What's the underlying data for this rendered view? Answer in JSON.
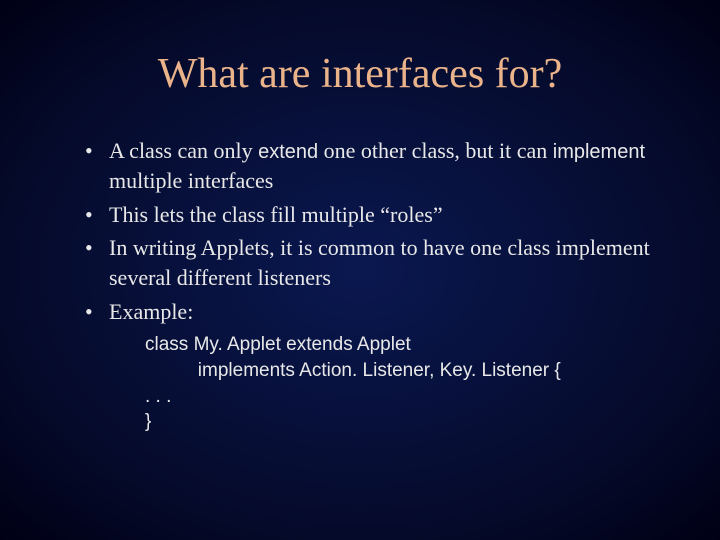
{
  "slide": {
    "title": "What are interfaces for?",
    "bullets": {
      "b1_a": "A class can only ",
      "b1_kw1": "extend",
      "b1_b": " one other class, but it can ",
      "b1_kw2": "implement",
      "b1_c": " multiple interfaces",
      "b2": "This lets the class fill multiple “roles”",
      "b3": "In writing Applets, it is common to have one class implement several different listeners",
      "b4": "Example:"
    },
    "code": "class My. Applet extends Applet\n          implements Action. Listener, Key. Listener {\n. . .\n}"
  }
}
